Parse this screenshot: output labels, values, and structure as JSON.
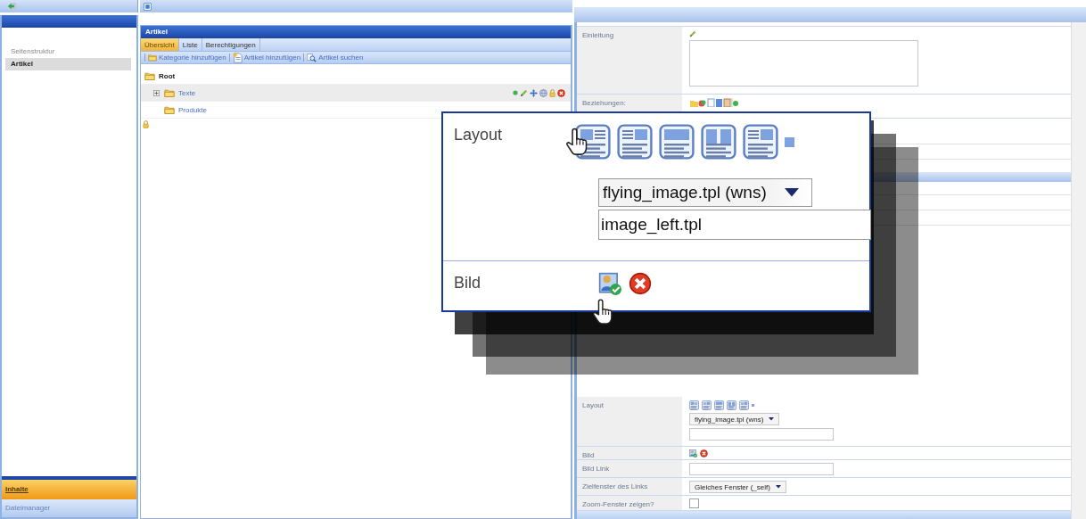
{
  "sidebar": {
    "items": [
      {
        "label": "Seitenstruktur",
        "selected": false
      },
      {
        "label": "Artikel",
        "selected": true
      }
    ],
    "modules": [
      {
        "label": "Inhalte",
        "selected": true
      },
      {
        "label": "Dateimanager",
        "selected": false
      }
    ]
  },
  "articles": {
    "title": "Artikel",
    "tabs": [
      {
        "label": "Übersicht",
        "selected": true
      },
      {
        "label": "Liste",
        "selected": false
      },
      {
        "label": "Berechtigungen",
        "selected": false
      }
    ],
    "toolbar": [
      {
        "kind": "folder",
        "label": "Kategorie hinzufügen"
      },
      {
        "kind": "page",
        "label": "Artikel hinzufügen"
      },
      {
        "kind": "search",
        "label": "Artikel suchen"
      }
    ],
    "tree": [
      {
        "label": "Root",
        "selected": false,
        "children": [
          {
            "label": "Texte",
            "expanded": false,
            "selected": true
          },
          {
            "label": "Produkte",
            "selected": false
          }
        ]
      }
    ]
  },
  "form": {
    "rows": [
      {
        "kind": "textarea",
        "label": "Einleitung"
      },
      {
        "kind": "relations",
        "label": "Beziehungen:"
      },
      {
        "kind": "layout",
        "label": "Layout",
        "select": "flying_image.tpl (wns)"
      },
      {
        "kind": "image",
        "label": "Bild"
      },
      {
        "kind": "input",
        "label": "Bild Link"
      },
      {
        "kind": "select",
        "label": "Zielfenster des Links",
        "value": "Gleiches Fenster (_self)"
      },
      {
        "kind": "checkbox",
        "label": "Zoom-Fenster zeigen?",
        "checked": false
      }
    ]
  },
  "callout": {
    "rows": [
      {
        "kind": "layout",
        "label": "Layout",
        "select": "flying_image.tpl (wns)",
        "value": "image_left.tpl"
      },
      {
        "kind": "image",
        "label": "Bild"
      }
    ]
  }
}
